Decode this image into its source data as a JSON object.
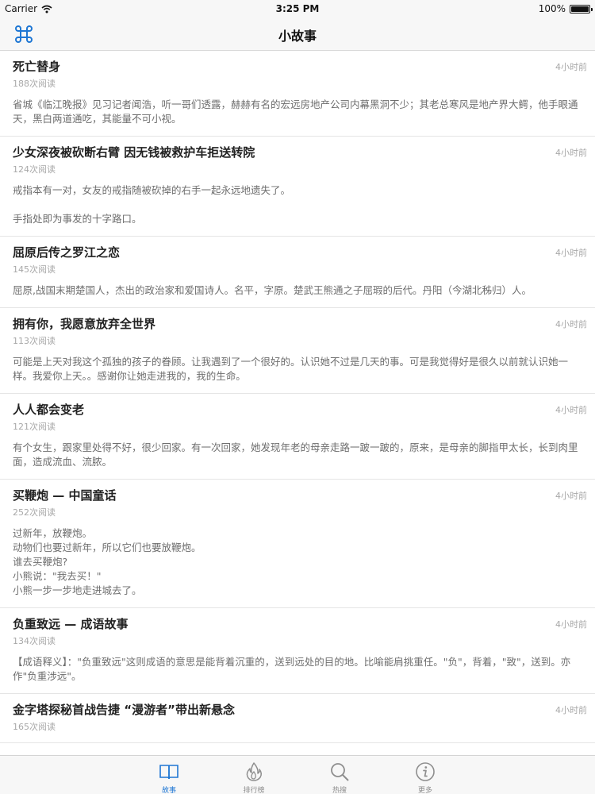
{
  "status_bar": {
    "carrier": "Carrier",
    "time": "3:25 PM",
    "battery": "100%",
    "battery_level": 1.0
  },
  "nav": {
    "title": "小故事",
    "left_icon": "command-icon",
    "accent": "#1f77d4"
  },
  "stories": [
    {
      "title": "死亡替身",
      "time": "4小时前",
      "reads": "188次阅读",
      "summary": "省城《临江晚报》见习记者闻浩，听一哥们透露，赫赫有名的宏远房地产公司内幕黑洞不少；其老总寒风是地产界大鳄，他手眼通天，黑白两道通吃，其能量不可小视。"
    },
    {
      "title": "少女深夜被砍断右臂 因无钱被救护车拒送转院",
      "time": "4小时前",
      "reads": "124次阅读",
      "summary": "戒指本有一对，女友的戒指随被砍掉的右手一起永远地遗失了。\n\n手指处即为事发的十字路口。"
    },
    {
      "title": "屈原后传之罗江之恋",
      "time": "4小时前",
      "reads": "145次阅读",
      "summary": "屈原,战国末期楚国人，杰出的政治家和爱国诗人。名平，字原。楚武王熊通之子屈瑕的后代。丹阳（今湖北秭归）人。"
    },
    {
      "title": "拥有你，我愿意放弃全世界",
      "time": "4小时前",
      "reads": "113次阅读",
      "summary": "可能是上天对我这个孤独的孩子的眷顾。让我遇到了一个很好的。认识她不过是几天的事。可是我觉得好是很久以前就认识她一样。我爱你上天。。感谢你让她走进我的，我的生命。"
    },
    {
      "title": "人人都会变老",
      "time": "4小时前",
      "reads": "121次阅读",
      "summary": "有个女生，跟家里处得不好，很少回家。有一次回家，她发现年老的母亲走路一跛一跛的，原来，是母亲的脚指甲太长，长到肉里面，造成流血、流脓。"
    },
    {
      "title": "买鞭炮 — 中国童话",
      "time": "4小时前",
      "reads": "252次阅读",
      "summary": "过新年，放鞭炮。\n动物们也要过新年，所以它们也要放鞭炮。\n谁去买鞭炮?\n小熊说：\"我去买！\"\n小熊一步一步地走进城去了。"
    },
    {
      "title": "负重致远 — 成语故事",
      "time": "4小时前",
      "reads": "134次阅读",
      "summary": "【成语释义】：\"负重致远\"这则成语的意思是能背着沉重的，送到远处的目的地。比喻能肩挑重任。\"负\"，背着，\"致\"，送到。亦作\"负重涉远\"。"
    },
    {
      "title": "金字塔探秘首战告捷 “漫游者”带出新悬念",
      "time": "4小时前",
      "reads": "165次阅读",
      "summary": ""
    }
  ],
  "tabs": [
    {
      "label": "故事",
      "icon": "book-icon",
      "active": true
    },
    {
      "label": "排行榜",
      "icon": "flame-icon",
      "active": false
    },
    {
      "label": "热搜",
      "icon": "search-icon",
      "active": false
    },
    {
      "label": "更多",
      "icon": "info-icon",
      "active": false
    }
  ]
}
